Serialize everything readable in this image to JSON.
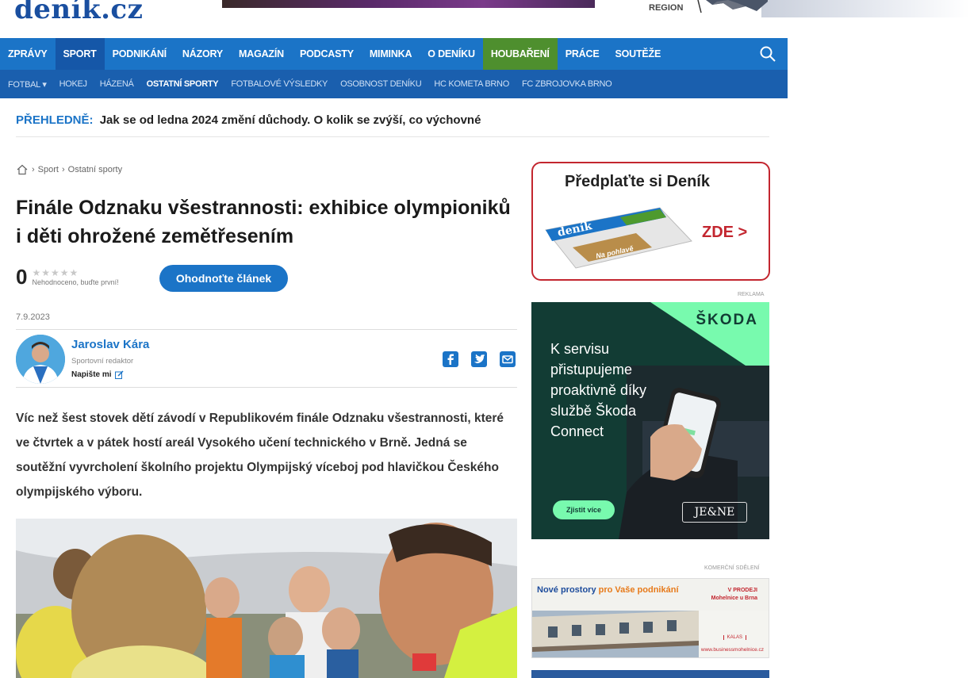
{
  "site": {
    "logo": "deník.cz",
    "region_label": "REGION"
  },
  "main_nav": [
    {
      "label": "ZPRÁVY",
      "state": "normal"
    },
    {
      "label": "SPORT",
      "state": "active"
    },
    {
      "label": "PODNIKÁNÍ",
      "state": "normal"
    },
    {
      "label": "NÁZORY",
      "state": "normal"
    },
    {
      "label": "MAGAZÍN",
      "state": "normal"
    },
    {
      "label": "PODCASTY",
      "state": "normal"
    },
    {
      "label": "MIMINKA",
      "state": "normal"
    },
    {
      "label": "O DENÍKU",
      "state": "normal"
    },
    {
      "label": "HOUBAŘENÍ",
      "state": "highlight"
    },
    {
      "label": "PRÁCE",
      "state": "normal"
    },
    {
      "label": "SOUTĚŽE",
      "state": "normal"
    }
  ],
  "sub_nav": [
    {
      "label": "FOTBAL ▾",
      "active": false
    },
    {
      "label": "HOKEJ",
      "active": false
    },
    {
      "label": "HÁZENÁ",
      "active": false
    },
    {
      "label": "OSTATNÍ SPORTY",
      "active": true
    },
    {
      "label": "FOTBALOVÉ VÝSLEDKY",
      "active": false
    },
    {
      "label": "OSOBNOST DENÍKU",
      "active": false
    },
    {
      "label": "HC KOMETA BRNO",
      "active": false
    },
    {
      "label": "FC ZBROJOVKA BRNO",
      "active": false
    }
  ],
  "ticker": {
    "label": "PŘEHLEDNĚ:",
    "text": "Jak se od ledna 2024 změní důchody. O kolik se zvýší, co výchovné"
  },
  "breadcrumb": {
    "sep1": "›",
    "item1": "Sport",
    "sep2": "›",
    "item2": "Ostatní sporty"
  },
  "article": {
    "headline": "Finále Odznaku všestrannosti: exhibice olympioniků i děti ohrožené zemětřesením",
    "rating_count": "0",
    "rating_stars": "★★★★★",
    "rating_note": "Nehodnoceno, buďte první!",
    "rate_button": "Ohodnoťte článek",
    "date": "7.9.2023",
    "author": {
      "name": "Jaroslav Kára",
      "role": "Sportovní redaktor",
      "write": "Napište mi"
    },
    "perex": "Víc než šest stovek dětí závodí v Republikovém finále Odznaku všestrannosti, které ve čtvrtek a v pátek hostí areál Vysokého učení technického v Brně. Jedná se soutěžní vyvrcholení školního projektu Olympijský víceboj pod hlavičkou Českého olympijského výboru."
  },
  "sidebar": {
    "promo": {
      "title": "Předplaťte si Deník",
      "cta": "ZDE >",
      "paper_brand": "deník",
      "paper_tag": "Na pohlavě"
    },
    "ad_label": "REKLAMA",
    "skoda": {
      "brand": "ŠKODA",
      "text": "K servisu přistupujeme proaktivně díky službě Škoda Connect",
      "button": "Zjistit více",
      "dealer": "JE&NE"
    },
    "commercial_label": "KOMERČNÍ SDĚLENÍ",
    "estate": {
      "title_a": "Nové prostory",
      "title_b": "pro Vaše podnikání",
      "sale": "V PRODEJI",
      "sale_sub": "Mohelnice u Brna",
      "logo": "KALAS",
      "url": "www.businessmohelnice.cz"
    }
  },
  "colors": {
    "brand_blue": "#1b74c7",
    "nav_active": "#1557a8",
    "nav_highlight": "#4e8f2e",
    "promo_red": "#c3262f",
    "skoda_dark": "#123c34",
    "skoda_green": "#78faae"
  }
}
